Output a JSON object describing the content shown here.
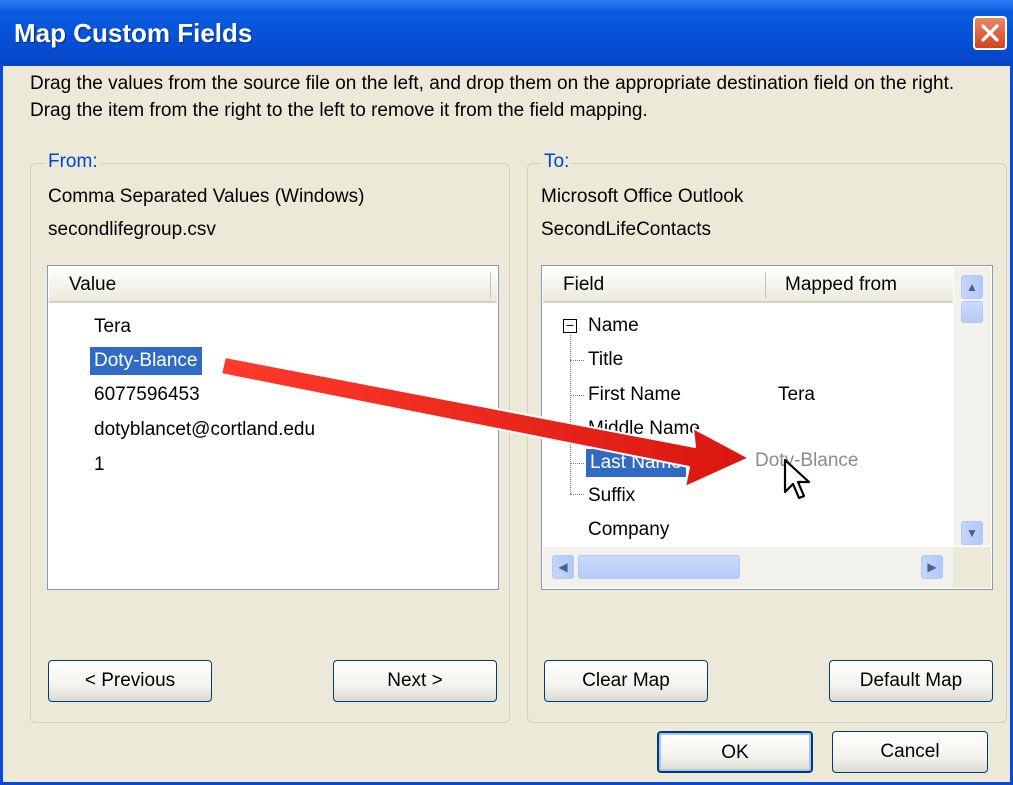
{
  "window": {
    "title": "Map Custom Fields"
  },
  "instructions": "Drag the values from the source file on the left, and drop them on the appropriate destination field on the right.  Drag the item from the right to the left to remove it from the field mapping.",
  "from": {
    "legend": "From:",
    "source_type": "Comma Separated Values (Windows)",
    "file_name": "secondlifegroup.csv",
    "column_header": "Value",
    "values": [
      "Tera",
      "Doty-Blance",
      "6077596453",
      "dotyblancet@cortland.edu",
      "1"
    ],
    "selected_index": 1,
    "previous_label": "< Previous",
    "next_label": "Next >"
  },
  "to": {
    "legend": "To:",
    "app_name": "Microsoft Office Outlook",
    "folder_name": "SecondLifeContacts",
    "field_header": "Field",
    "mapped_header": "Mapped from",
    "group_toggle": "−",
    "group_name": "Name",
    "fields": [
      {
        "name": "Title",
        "mapped": ""
      },
      {
        "name": "First Name",
        "mapped": "Tera"
      },
      {
        "name": "Middle Name",
        "mapped": ""
      },
      {
        "name": "Last Name",
        "mapped": "Doty-Blance"
      },
      {
        "name": "Suffix",
        "mapped": ""
      }
    ],
    "next_group": "Company",
    "clear_label": "Clear Map",
    "default_label": "Default Map"
  },
  "footer": {
    "ok_label": "OK",
    "cancel_label": "Cancel"
  },
  "icons": {
    "close": "close-icon",
    "drag_arrow": "drag-arrow-icon",
    "cursor": "mouse-cursor-icon",
    "scroll_up": "scroll-up-icon",
    "scroll_down": "scroll-down-icon",
    "scroll_left": "scroll-left-icon",
    "scroll_right": "scroll-right-icon"
  },
  "colors": {
    "titlebar": "#0550d6",
    "selection": "#316ac5",
    "legend_text": "#0046d5",
    "drag_arrow": "#e8231c",
    "close_button": "#d2431b"
  }
}
